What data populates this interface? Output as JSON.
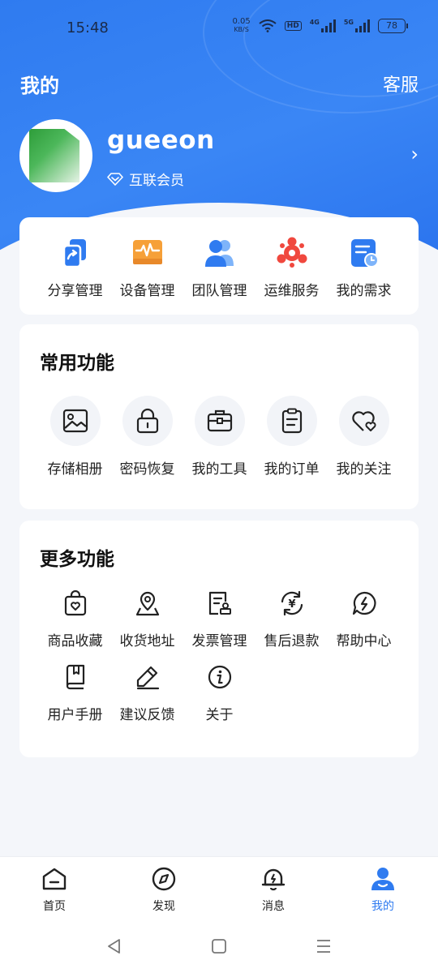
{
  "status": {
    "time": "15:48",
    "speed_value": "0.05",
    "speed_unit": "KB/S",
    "hd": "HD",
    "net1": "4G",
    "net2": "5G",
    "battery": "78"
  },
  "header": {
    "title": "我的",
    "service": "客服"
  },
  "profile": {
    "username": "gueeon",
    "member_label": "互联会员"
  },
  "quick": [
    {
      "label": "分享管理",
      "icon": "share-manage-icon"
    },
    {
      "label": "设备管理",
      "icon": "device-manage-icon"
    },
    {
      "label": "团队管理",
      "icon": "team-manage-icon"
    },
    {
      "label": "运维服务",
      "icon": "ops-service-icon"
    },
    {
      "label": "我的需求",
      "icon": "my-needs-icon"
    }
  ],
  "common": {
    "title": "常用功能",
    "items": [
      {
        "label": "存储相册",
        "icon": "album-icon"
      },
      {
        "label": "密码恢复",
        "icon": "lock-icon"
      },
      {
        "label": "我的工具",
        "icon": "toolbox-icon"
      },
      {
        "label": "我的订单",
        "icon": "clipboard-icon"
      },
      {
        "label": "我的关注",
        "icon": "heart-icon"
      }
    ]
  },
  "more": {
    "title": "更多功能",
    "items": [
      {
        "label": "商品收藏",
        "icon": "shopping-bag-heart-icon"
      },
      {
        "label": "收货地址",
        "icon": "map-pin-icon"
      },
      {
        "label": "发票管理",
        "icon": "invoice-icon"
      },
      {
        "label": "售后退款",
        "icon": "refund-icon"
      },
      {
        "label": "帮助中心",
        "icon": "help-chat-icon"
      },
      {
        "label": "用户手册",
        "icon": "book-icon"
      },
      {
        "label": "建议反馈",
        "icon": "pencil-icon"
      },
      {
        "label": "关于",
        "icon": "info-icon"
      }
    ]
  },
  "nav": [
    {
      "label": "首页",
      "icon": "home-icon"
    },
    {
      "label": "发现",
      "icon": "compass-icon"
    },
    {
      "label": "消息",
      "icon": "bell-icon"
    },
    {
      "label": "我的",
      "icon": "profile-icon",
      "active": true
    }
  ],
  "colors": {
    "primary": "#2f7bf0",
    "background": "#f4f6fa",
    "card": "#ffffff",
    "accent_orange": "#f6a038",
    "accent_red": "#f0483e"
  }
}
